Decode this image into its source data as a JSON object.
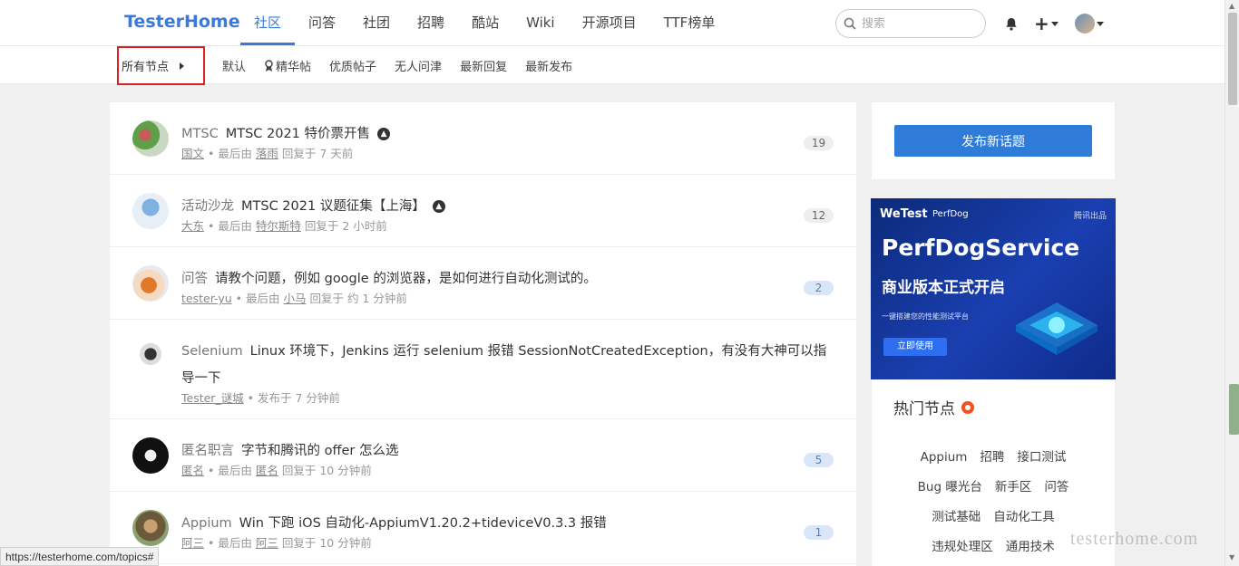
{
  "header": {
    "brand": "TesterHome",
    "nav": [
      "社区",
      "问答",
      "社团",
      "招聘",
      "酷站",
      "Wiki",
      "开源项目",
      "TTF榜单"
    ],
    "search_placeholder": "搜索",
    "plus": "+"
  },
  "subnav": {
    "all_nodes": "所有节点",
    "filters": [
      "默认",
      "精华帖",
      "优质帖子",
      "无人问津",
      "最新回复",
      "最新发布"
    ]
  },
  "topics": [
    {
      "node": "MTSC",
      "title": "MTSC 2021 特价票开售",
      "pinned": true,
      "author": "国文",
      "meta_mid": "最后由",
      "replier": "落雨",
      "time": "回复于 7 天前",
      "count": "19"
    },
    {
      "node": "活动沙龙",
      "title": "MTSC 2021 议题征集【上海】",
      "pinned": true,
      "author": "大东",
      "meta_mid": "最后由",
      "replier": "特尔斯特",
      "time": "回复于 2 小时前",
      "count": "12"
    },
    {
      "node": "问答",
      "title": "请教个问题，例如 google 的浏览器，是如何进行自动化测试的。",
      "pinned": false,
      "author": "tester-yu",
      "meta_mid": "最后由",
      "replier": "小马",
      "time": "回复于 约 1 分钟前",
      "count": "2"
    },
    {
      "node": "Selenium",
      "title": "Linux 环境下，Jenkins 运行 selenium 报错 SessionNotCreatedException，有没有大神可以指导一下",
      "pinned": false,
      "author": "Tester_谜城",
      "meta_mid": "",
      "replier": "",
      "time": "发布于 7 分钟前",
      "count": ""
    },
    {
      "node": "匿名职言",
      "title": "字节和腾讯的 offer 怎么选",
      "pinned": false,
      "author": "匿名",
      "meta_mid": "最后由",
      "replier": "匿名",
      "time": "回复于 10 分钟前",
      "count": "5"
    },
    {
      "node": "Appium",
      "title": "Win 下跑 iOS 自动化-AppiumV1.20.2+tideviceV0.3.3 报错",
      "pinned": false,
      "author": "阿三",
      "meta_mid": "最后由",
      "replier": "阿三",
      "time": "回复于 10 分钟前",
      "count": "1"
    }
  ],
  "sidebar": {
    "post_button": "发布新话题",
    "banner": {
      "brand1": "WeTest",
      "brand2": "PerfDog",
      "corner": "腾讯出品",
      "headline": "PerfDogService",
      "subheadline": "商业版本正式开启",
      "tagline": "一键搭建您的性能测试平台",
      "cta": "立即使用"
    },
    "hot_title": "热门节点",
    "hot_nodes": [
      [
        "Appium",
        "招聘",
        "接口测试"
      ],
      [
        "Bug 曝光台",
        "新手区",
        "问答"
      ],
      [
        "测试基础",
        "自动化工具"
      ],
      [
        "违规处理区",
        "通用技术"
      ]
    ]
  },
  "status_url": "https://testerhome.com/topics#",
  "watermark": "testerhome.com",
  "colors": {
    "accent": "#3b7ad9",
    "button": "#2f7bd8",
    "highlight_box": "#e02020"
  }
}
